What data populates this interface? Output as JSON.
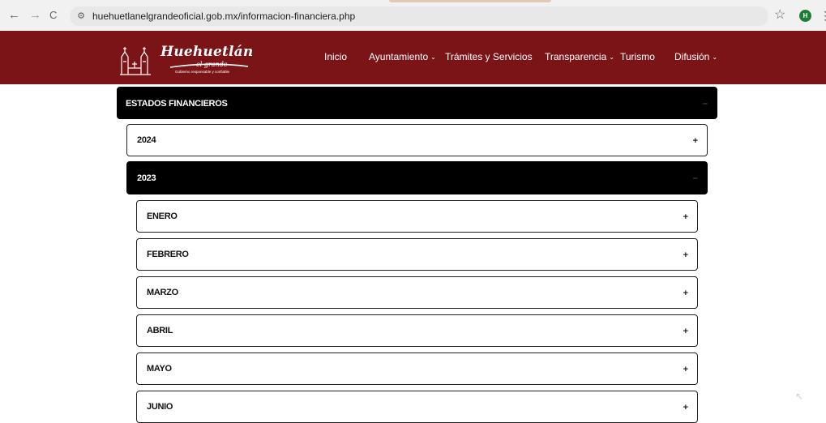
{
  "browser": {
    "url": "huehuetlanelgrandeoficial.gob.mx/informacion-financiera.php",
    "back_icon": "←",
    "forward_icon": "→",
    "reload_icon": "C",
    "site_info_icon": "⚙",
    "bookmark_icon": "☆",
    "profile_initial": "H",
    "menu_icon": "⋮"
  },
  "header": {
    "brand": "Huehuetlán",
    "brand_sub": "el grande",
    "tagline": "Gobierno responsable y confiable",
    "nav": [
      {
        "label": "Inicio"
      },
      {
        "label": "Ayuntamiento",
        "chevron": "⌄"
      },
      {
        "label": "Trámites y Servicios"
      },
      {
        "label": "Transparencia",
        "chevron": "⌄"
      },
      {
        "label": "Turismo"
      },
      {
        "label": "Difusión",
        "chevron": "⌄"
      }
    ]
  },
  "accordion": {
    "title": "ESTADOS FINANCIEROS",
    "title_toggle": "–",
    "years": [
      {
        "label": "2024",
        "toggle": "+"
      },
      {
        "label": "2023",
        "toggle": "–"
      }
    ],
    "months": [
      {
        "label": "ENERO",
        "toggle": "+"
      },
      {
        "label": "FEBRERO",
        "toggle": "+"
      },
      {
        "label": "MARZO",
        "toggle": "+"
      },
      {
        "label": "ABRIL",
        "toggle": "+"
      },
      {
        "label": "MAYO",
        "toggle": "+"
      },
      {
        "label": "JUNIO",
        "toggle": "+"
      }
    ]
  },
  "colors": {
    "header_bg": "#7b1417",
    "dark_panel": "#000000"
  }
}
